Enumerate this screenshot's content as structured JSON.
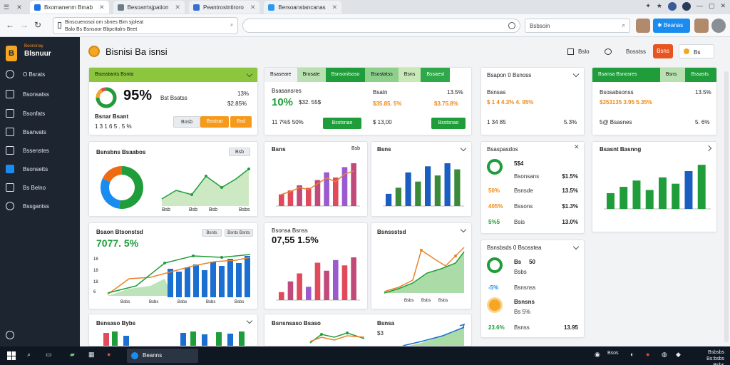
{
  "browser": {
    "tabs": [
      {
        "label": "Bxomanenm Bmab",
        "active": true
      },
      {
        "label": "Besoarrtsjpation",
        "active": false
      },
      {
        "label": "Peantrostntiroro",
        "active": false
      },
      {
        "label": "Bersoanstancanas",
        "active": false
      }
    ],
    "url_line1": "Binscuenosoi om sbnes Bim sjoleat",
    "url_line2": "Balo Bs Bsnsoor Bbpcttalrs Beet",
    "search_placeholder": "Bsbsoin",
    "action_button": "Beanas"
  },
  "sidebar": {
    "brand_small": "Boonsnay",
    "brand_name": "Blsnuur",
    "items": [
      {
        "label": "O Bsrats",
        "icon": "dashboard-icon",
        "active": false
      },
      {
        "label": "Bsonsatss",
        "icon": "lock-icon",
        "active": false
      },
      {
        "label": "Bsonfats",
        "icon": "rocket-icon",
        "active": false
      },
      {
        "label": "Bsanvats",
        "icon": "chart-icon",
        "active": false
      },
      {
        "label": "Bssenstes",
        "icon": "document-icon",
        "active": false
      },
      {
        "label": "Bsonsetts",
        "icon": "reports-icon",
        "active": true
      },
      {
        "label": "Bs Belno",
        "icon": "home-icon",
        "active": false
      },
      {
        "label": "Bssgantss",
        "icon": "settings-icon",
        "active": false
      }
    ]
  },
  "header": {
    "title": "Bisnisi Ba isnsi",
    "action1": "Bslo",
    "action2": "Bosstss",
    "primary_button": "Bsns",
    "pill_label": "Bs"
  },
  "cards": {
    "summary1": {
      "bar_left": "Bsosstants Bsnta",
      "percent": "95%",
      "label_mid": "Bst Bsatss",
      "stat1": "13%",
      "stat2": "$2.85%",
      "caption": "Bsnar Bsant",
      "caption_value": "1 3 1 6 5 . 5 %",
      "btn1": "Bosb",
      "btn2": "Bsstsat",
      "btn3": "Bsd"
    },
    "summary2": {
      "tabs": [
        "Bsaseare",
        "Brosate",
        "Bsnsonlsoso",
        "Bsostatss",
        "Bsns",
        "Bssaest"
      ],
      "label": "Bsasansres",
      "big": "10%",
      "big_suffix": "$32. 55$",
      "label2": "Bsatn",
      "val2a": "13.5%",
      "val2b": "$35.85. 5%",
      "val2c": "$3.75.8%",
      "row_text": "11 7%5 50%",
      "btn_green": "Bsstsnao",
      "row_mid": "$ 13,00",
      "btn_green2": "Bsstsnao"
    },
    "summary3": {
      "title": "Bsapon 0 Bsnoss",
      "label": "Bsnsas",
      "value": "$ 1 4 4.3% 4. 95%",
      "row": "1 34 85",
      "pct": "5.3%"
    },
    "summary4": {
      "tabs": [
        "Bsansa Bsnosres",
        "Bsns",
        "Bssasts"
      ],
      "label": "Bsosabsonss",
      "value": "$353135 3.95 5.35%",
      "pct": "13.5%",
      "row": "5@ Bsasnes",
      "row_pct": "5. 6%"
    },
    "donut": {
      "title": "Bsnsbns Bsaabos",
      "pill": "Bsb",
      "ticks": [
        "Bsb",
        "Bsb",
        "Bsb",
        "Bsbs"
      ]
    },
    "bars1": {
      "title": "Bsns",
      "corner": "Bsb"
    },
    "bars2": {
      "title": "Bsns"
    },
    "list1": {
      "title": "Bsaspasdos",
      "rows": [
        {
          "v1": "5$4",
          "label": "Bsonsans",
          "v2": "$1.5%"
        },
        {
          "v1": "50%",
          "label": "Bsnsde",
          "v2": "13.5%"
        },
        {
          "v1": "405%",
          "label": "Bssons",
          "v2": "$1.3%"
        },
        {
          "v1": "5%5",
          "label": "Bsis",
          "v2": "13.0%"
        }
      ]
    },
    "bars3": {
      "title": "Bsasnt Basnng"
    },
    "combo": {
      "title": "Bsaon Btsonstsd",
      "value": "7077. 5%",
      "pills": [
        "Bsnts",
        "Bsnts Bsnts"
      ],
      "ylabels": [
        "6",
        "18",
        "18",
        "18",
        "18"
      ],
      "xlabels": [
        "Bsbs",
        "Bsbs",
        "Bsbs",
        "Bsbs",
        "Bsbs",
        "Bsbs",
        "Bsbs"
      ]
    },
    "bars4": {
      "title": "Bsonsa Bsnss",
      "value": "07,55 1.5%"
    },
    "area2": {
      "title": "Bsnssstsd",
      "legend": [
        "Bsbs",
        "Bsbs",
        "Bsbs"
      ]
    },
    "list2": {
      "title": "Bsnsbsds 0 Bsosstea",
      "rows": [
        {
          "v1": "Bs",
          "label": "Bsbs",
          "v2": "50"
        },
        {
          "v1": "-5%",
          "label": "Bsnsnss",
          "v2": ""
        },
        {
          "v1": "Bsnsns",
          "label": "Bs 5%",
          "v2": ""
        },
        {
          "v1": "23.6%",
          "label": "Bsnss",
          "v2": "13.95"
        }
      ]
    },
    "bottom1": {
      "title": "Bsnsaso Bybs"
    },
    "bottom2": {
      "title": "Bsnsnsaso Bsaso",
      "right_title": "Bsnsa",
      "val": "$3"
    }
  },
  "chart_data": [
    {
      "type": "pie",
      "values": [
        52,
        30,
        18
      ],
      "colors": [
        "#1f9d3a",
        "#1a8cf0",
        "#ef6a12"
      ]
    },
    {
      "type": "bar",
      "values": [
        9,
        12,
        16,
        14,
        20,
        26,
        22,
        30,
        33
      ],
      "colors": [
        "#e04a5a",
        "#e04a5a",
        "#c04a7a",
        "#e04a5a",
        "#c04a7a",
        "#9a5ad0",
        "#e04a5a",
        "#9a5ad0",
        "#c04a7a"
      ]
    },
    {
      "type": "bar",
      "values": [
        8,
        12,
        22,
        16,
        26,
        20,
        28,
        24
      ],
      "colors": [
        "#1a5ec0",
        "#3a8a3a",
        "#1a5ec0",
        "#3a8a3a",
        "#1a5ec0",
        "#3a8a3a",
        "#1a5ec0",
        "#3a8a3a"
      ]
    },
    {
      "type": "bar",
      "values": [
        10,
        14,
        18,
        12,
        20,
        16,
        24,
        28
      ],
      "colors": [
        "#1f9d3a",
        "#1f9d3a",
        "#1f9d3a",
        "#1f9d3a",
        "#1f9d3a",
        "#1f9d3a",
        "#1a5ec0",
        "#1f9d3a"
      ]
    },
    {
      "type": "bar",
      "values": [
        6,
        14,
        20,
        10,
        28,
        22,
        30,
        26,
        32
      ],
      "colors": [
        "#e04a5a",
        "#c04a7a",
        "#e04a5a",
        "#9a5ad0",
        "#e04a5a",
        "#c04a7a",
        "#9a5ad0",
        "#e04a5a",
        "#c04a7a"
      ]
    }
  ]
}
